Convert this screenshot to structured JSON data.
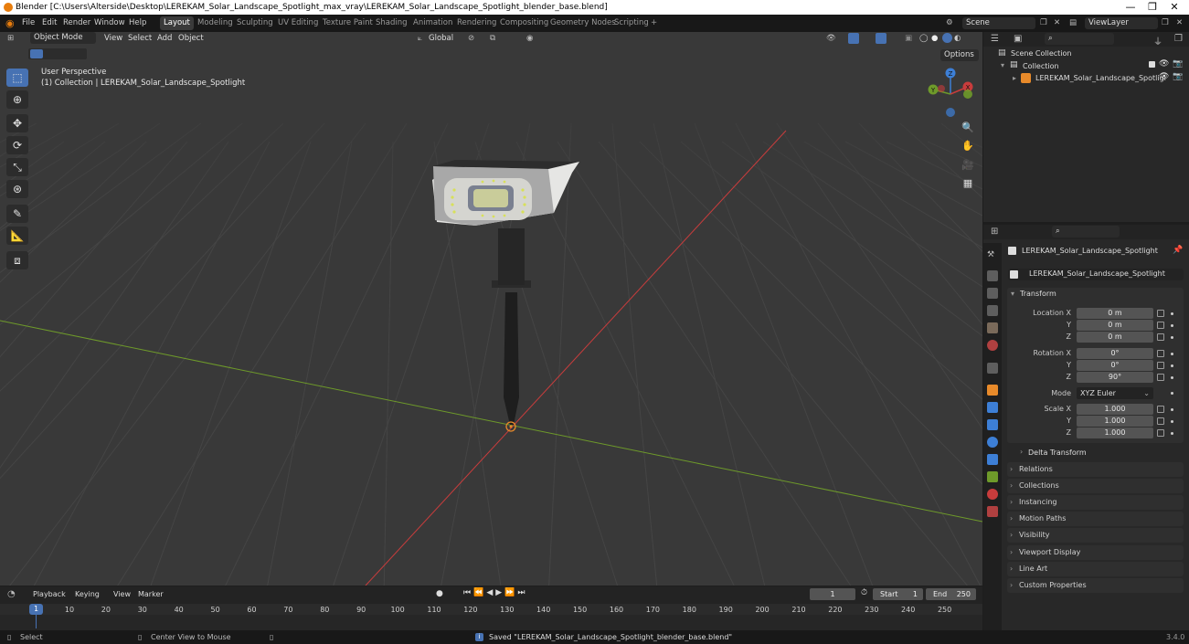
{
  "window": {
    "title": "Blender [C:\\Users\\Alterside\\Desktop\\LEREKAM_Solar_Landscape_Spotlight_max_vray\\LEREKAM_Solar_Landscape_Spotlight_blender_base.blend]",
    "controls": {
      "minimize": "—",
      "maximize": "❐",
      "close": "✕"
    }
  },
  "menu": [
    "File",
    "Edit",
    "Render",
    "Window",
    "Help"
  ],
  "workspaces": [
    "Layout",
    "Modeling",
    "Sculpting",
    "UV Editing",
    "Texture Paint",
    "Shading",
    "Animation",
    "Rendering",
    "Compositing",
    "Geometry Nodes",
    "Scripting",
    "+"
  ],
  "scene": {
    "label": "Scene",
    "view_layer": "ViewLayer"
  },
  "viewport": {
    "mode": "Object Mode",
    "menus": [
      "View",
      "Select",
      "Add",
      "Object"
    ],
    "transform_orientation": "Global",
    "options_label": "Options",
    "overlay_line1": "User Perspective",
    "overlay_line2": "(1) Collection | LEREKAM_Solar_Landscape_Spotlight",
    "gizmo_axes": {
      "x": "X",
      "y": "Y",
      "z": "Z"
    }
  },
  "outliner": {
    "root": "Scene Collection",
    "collection": "Collection",
    "object": "LEREKAM_Solar_Landscape_Spotligl"
  },
  "properties": {
    "object_name": "LEREKAM_Solar_Landscape_Spotlight",
    "datablock_name": "LEREKAM_Solar_Landscape_Spotlight",
    "transform_header": "Transform",
    "location": {
      "label": "Location X",
      "x": "0 m",
      "y": "0 m",
      "z": "0 m"
    },
    "rotation": {
      "label": "Rotation X",
      "x": "0°",
      "y": "0°",
      "z": "90°"
    },
    "mode": {
      "label": "Mode",
      "value": "XYZ Euler"
    },
    "scale": {
      "label": "Scale X",
      "x": "1.000",
      "y": "1.000",
      "z": "1.000"
    },
    "axis_labels": {
      "y": "Y",
      "z": "Z"
    },
    "delta_transform": "Delta Transform",
    "panels": [
      "Relations",
      "Collections",
      "Instancing",
      "Motion Paths",
      "Visibility",
      "Viewport Display",
      "Line Art",
      "Custom Properties"
    ]
  },
  "timeline": {
    "menus": [
      "Playback",
      "Keying",
      "View",
      "Marker"
    ],
    "current_frame": "1",
    "start_label": "Start",
    "start": "1",
    "end_label": "End",
    "end": "250",
    "ruler": [
      "10",
      "20",
      "30",
      "40",
      "50",
      "60",
      "70",
      "80",
      "90",
      "100",
      "110",
      "120",
      "130",
      "140",
      "150",
      "160",
      "170",
      "180",
      "190",
      "200",
      "210",
      "220",
      "230",
      "240",
      "250"
    ],
    "playhead": "1"
  },
  "status": {
    "select": "Select",
    "center_view": "Center View to Mouse",
    "message": "Saved \"LEREKAM_Solar_Landscape_Spotlight_blender_base.blend\"",
    "version": "3.4.0"
  },
  "colors": {
    "accent": "#4772b3",
    "x_axis": "#c83c3c",
    "y_axis": "#6e9a2a",
    "z_axis": "#3d7fd6",
    "object": "#e88a2a"
  }
}
